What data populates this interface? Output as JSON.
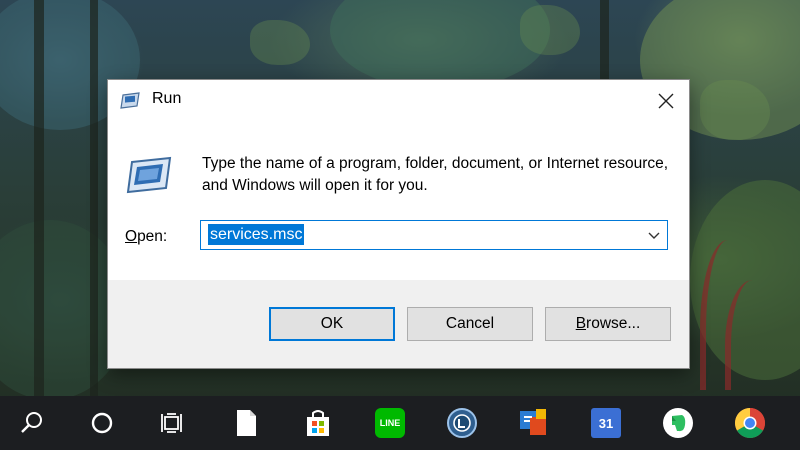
{
  "dialog": {
    "title": "Run",
    "description": "Type the name of a program, folder, document, or Internet resource, and Windows will open it for you.",
    "open_label_mnemonic": "O",
    "open_label_rest": "pen:",
    "open_value": "services.msc",
    "buttons": {
      "ok": "OK",
      "cancel": "Cancel",
      "browse_mnemonic": "B",
      "browse_rest": "rowse..."
    }
  },
  "taskbar": {
    "line_label": "LINE",
    "calendar_day": "31",
    "items": [
      {
        "name": "search-icon"
      },
      {
        "name": "cortana-icon"
      },
      {
        "name": "task-view-icon"
      },
      {
        "name": "file-icon"
      },
      {
        "name": "store-icon"
      },
      {
        "name": "line-app-icon"
      },
      {
        "name": "music-app-icon"
      },
      {
        "name": "office-app-icon"
      },
      {
        "name": "calendar-app-icon"
      },
      {
        "name": "evernote-icon"
      },
      {
        "name": "chrome-icon"
      }
    ]
  },
  "colors": {
    "accent": "#0078d7",
    "taskbar": "#1c1e21",
    "footer": "#f0f0f0"
  }
}
